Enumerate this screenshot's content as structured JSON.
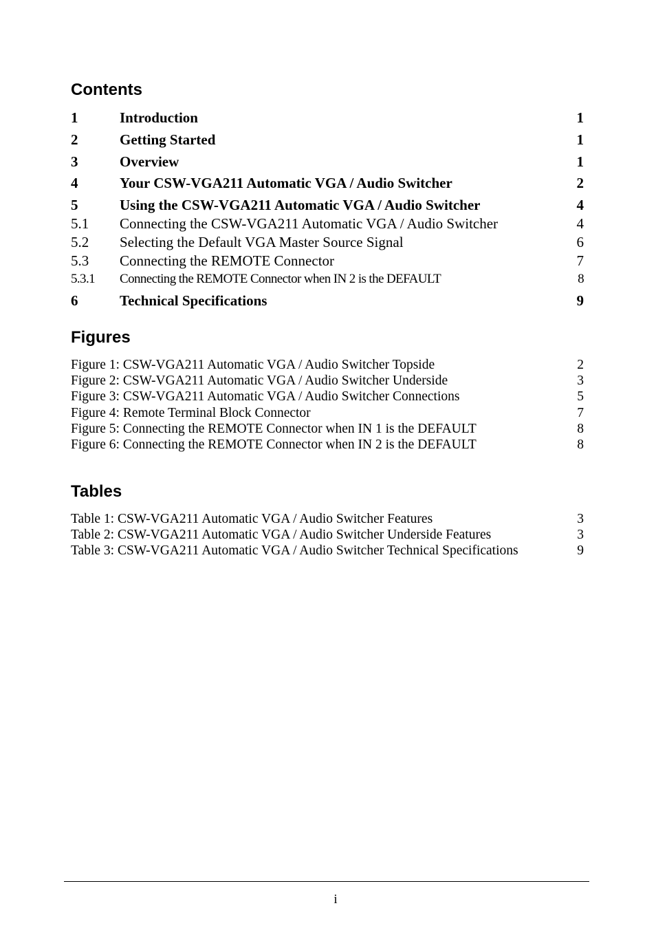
{
  "contents": {
    "heading": "Contents",
    "entries": [
      {
        "number": "1",
        "title": "Introduction",
        "page": "1",
        "level": 1
      },
      {
        "number": "2",
        "title": "Getting Started",
        "page": "1",
        "level": 1
      },
      {
        "number": "3",
        "title": "Overview",
        "page": "1",
        "level": 1
      },
      {
        "number": "4",
        "title": "Your CSW-VGA211 Automatic VGA / Audio Switcher",
        "page": "2",
        "level": 1
      },
      {
        "number": "5",
        "title": "Using the CSW-VGA211 Automatic VGA / Audio Switcher",
        "page": "4",
        "level": 1
      },
      {
        "number": "5.1",
        "title": "Connecting the CSW-VGA211 Automatic VGA / Audio Switcher",
        "page": "4",
        "level": 2
      },
      {
        "number": "5.2",
        "title": "Selecting the Default VGA Master Source Signal",
        "page": "6",
        "level": 2
      },
      {
        "number": "5.3",
        "title": "Connecting the REMOTE Connector",
        "page": "7",
        "level": 2
      },
      {
        "number": "5.3.1",
        "title": "Connecting the REMOTE Connector when IN 2 is the DEFAULT",
        "page": "8",
        "level": 3
      },
      {
        "number": "6",
        "title": "Technical Specifications",
        "page": "9",
        "level": 1
      }
    ]
  },
  "figures": {
    "heading": "Figures",
    "entries": [
      {
        "title": "Figure 1: CSW-VGA211 Automatic VGA / Audio Switcher Topside",
        "page": "2"
      },
      {
        "title": "Figure 2: CSW-VGA211 Automatic VGA / Audio Switcher Underside",
        "page": "3"
      },
      {
        "title": "Figure 3: CSW-VGA211 Automatic VGA / Audio Switcher Connections",
        "page": "5"
      },
      {
        "title": "Figure 4: Remote Terminal Block Connector",
        "page": "7"
      },
      {
        "title": "Figure 5: Connecting the REMOTE Connector when IN 1 is the DEFAULT",
        "page": "8"
      },
      {
        "title": "Figure 6: Connecting the REMOTE Connector when IN 2 is the DEFAULT",
        "page": "8"
      }
    ]
  },
  "tables": {
    "heading": "Tables",
    "entries": [
      {
        "title": "Table 1: CSW-VGA211 Automatic VGA / Audio Switcher Features",
        "page": "3"
      },
      {
        "title": "Table 2: CSW-VGA211 Automatic VGA / Audio Switcher Underside Features",
        "page": "3"
      },
      {
        "title": "Table 3: CSW-VGA211 Automatic VGA / Audio Switcher Technical Specifications",
        "page": "9"
      }
    ]
  },
  "footer": {
    "page_number": "i"
  }
}
